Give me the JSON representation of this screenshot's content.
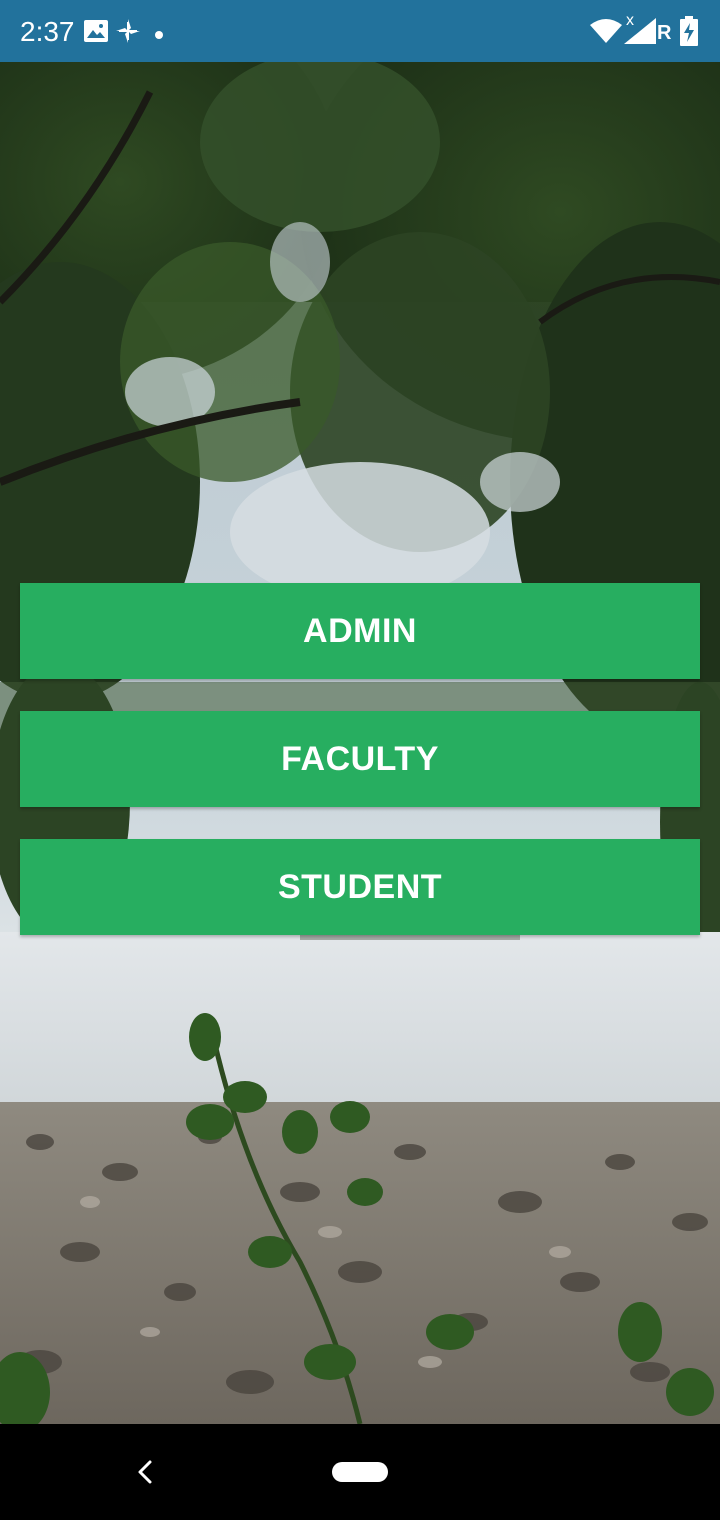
{
  "status_bar": {
    "time": "2:37",
    "network_label": "R",
    "icons": [
      "image-icon",
      "pinwheel-icon",
      "dot-icon",
      "wifi-icon",
      "signal-icon",
      "battery-charging-icon"
    ],
    "background_color": "#22729c"
  },
  "background_image": {
    "subject": "tree canopy over lake shore with rocky bank"
  },
  "buttons": [
    {
      "label": "ADMIN"
    },
    {
      "label": "FACULTY"
    },
    {
      "label": "STUDENT"
    }
  ],
  "button_color": "#27ae60",
  "nav_bar": {
    "icons": [
      "back-icon",
      "home-pill-icon"
    ]
  }
}
